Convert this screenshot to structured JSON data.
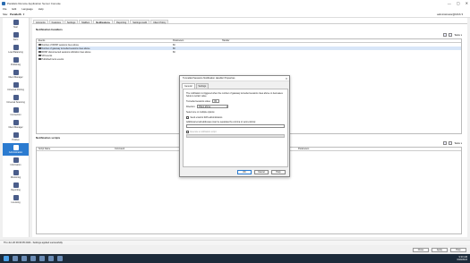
{
  "window": {
    "title": "Parallels Remote Application Server Console",
    "controls": [
      "—",
      "▢",
      "✕"
    ]
  },
  "menu": [
    "File",
    "Edit",
    "Language",
    "Help"
  ],
  "toolbar": {
    "site_label": "Site:",
    "site_value": "ParallelS",
    "user": "administrator@RAS ▾"
  },
  "sidebar": [
    {
      "label": "Start",
      "icon": "start-icon"
    },
    {
      "label": "Farm",
      "icon": "farm-icon"
    },
    {
      "label": "Load Balancing",
      "icon": "load-balancing-icon"
    },
    {
      "label": "Publishing",
      "icon": "publishing-icon"
    },
    {
      "label": "Client Manager",
      "icon": "client-manager-icon"
    },
    {
      "label": "Universal Printing",
      "icon": "printer-icon"
    },
    {
      "label": "Universal Scanning",
      "icon": "scanner-icon"
    },
    {
      "label": "Connection",
      "icon": "connection-icon"
    },
    {
      "label": "Client Manager",
      "icon": "client-icon"
    },
    {
      "label": "Policies",
      "icon": "policies-icon"
    },
    {
      "label": "Administration",
      "icon": "administration-icon"
    },
    {
      "label": "Information",
      "icon": "information-icon"
    },
    {
      "label": "Monitoring",
      "icon": "monitoring-icon"
    },
    {
      "label": "Reporting",
      "icon": "reporting-icon"
    },
    {
      "label": "Licensing",
      "icon": "licensing-icon"
    }
  ],
  "tabs": [
    "Accounts",
    "Features",
    "Settings",
    "Mailbox",
    "Notifications",
    "Reporting",
    "Settings Audit",
    "Client Policy"
  ],
  "active_tab": "Notifications",
  "handlers": {
    "title": "Notification handlers",
    "tasks": "Tasks ▾",
    "columns": [
      "Events",
      "Parameters",
      "Handler"
    ],
    "rows": [
      {
        "event": "Number of RDSH sessions rises above",
        "param": "80"
      },
      {
        "event": "Number of gateway tunnelled sessions rises above",
        "param": "80"
      },
      {
        "event": "RDSH disconnected sessions utilization rises above",
        "param": "80"
      },
      {
        "event": "VDI events",
        "param": ""
      },
      {
        "event": "Published items events",
        "param": ""
      }
    ]
  },
  "scripts": {
    "title": "Notification scripts",
    "tasks": "Tasks ▾",
    "columns": [
      "Script Name",
      "Command",
      "Parameters"
    ]
  },
  "status": {
    "text": "Thu Jun 20 09:30:05 2024 - Settings applied successfully.",
    "buttons": [
      "Close",
      "Apply",
      "Help"
    ]
  },
  "taskbar": {
    "time": "9:30 AM",
    "date": "6/20/2024"
  },
  "dialog": {
    "title": "Tunnelled Sessions Notification Handler Properties",
    "tabs": [
      "General",
      "Settings"
    ],
    "description": "The notification is triggered when the number of gateway tunnelled sessions rises above or decreases below a certain value.",
    "threshold_label": "Tunnelled sessions value:",
    "threshold_value": "80",
    "direction_label": "Direction:",
    "direction_value": "Rises above",
    "select_hint": "Select one or multiple options:",
    "send_email_label": "Send email to RAS administrators",
    "additional_email_label": "Additional email addresses (can be separated by comma or semi-colons):",
    "script_label": "Execute a notification script",
    "buttons": [
      "OK",
      "Cancel",
      "Help"
    ]
  }
}
